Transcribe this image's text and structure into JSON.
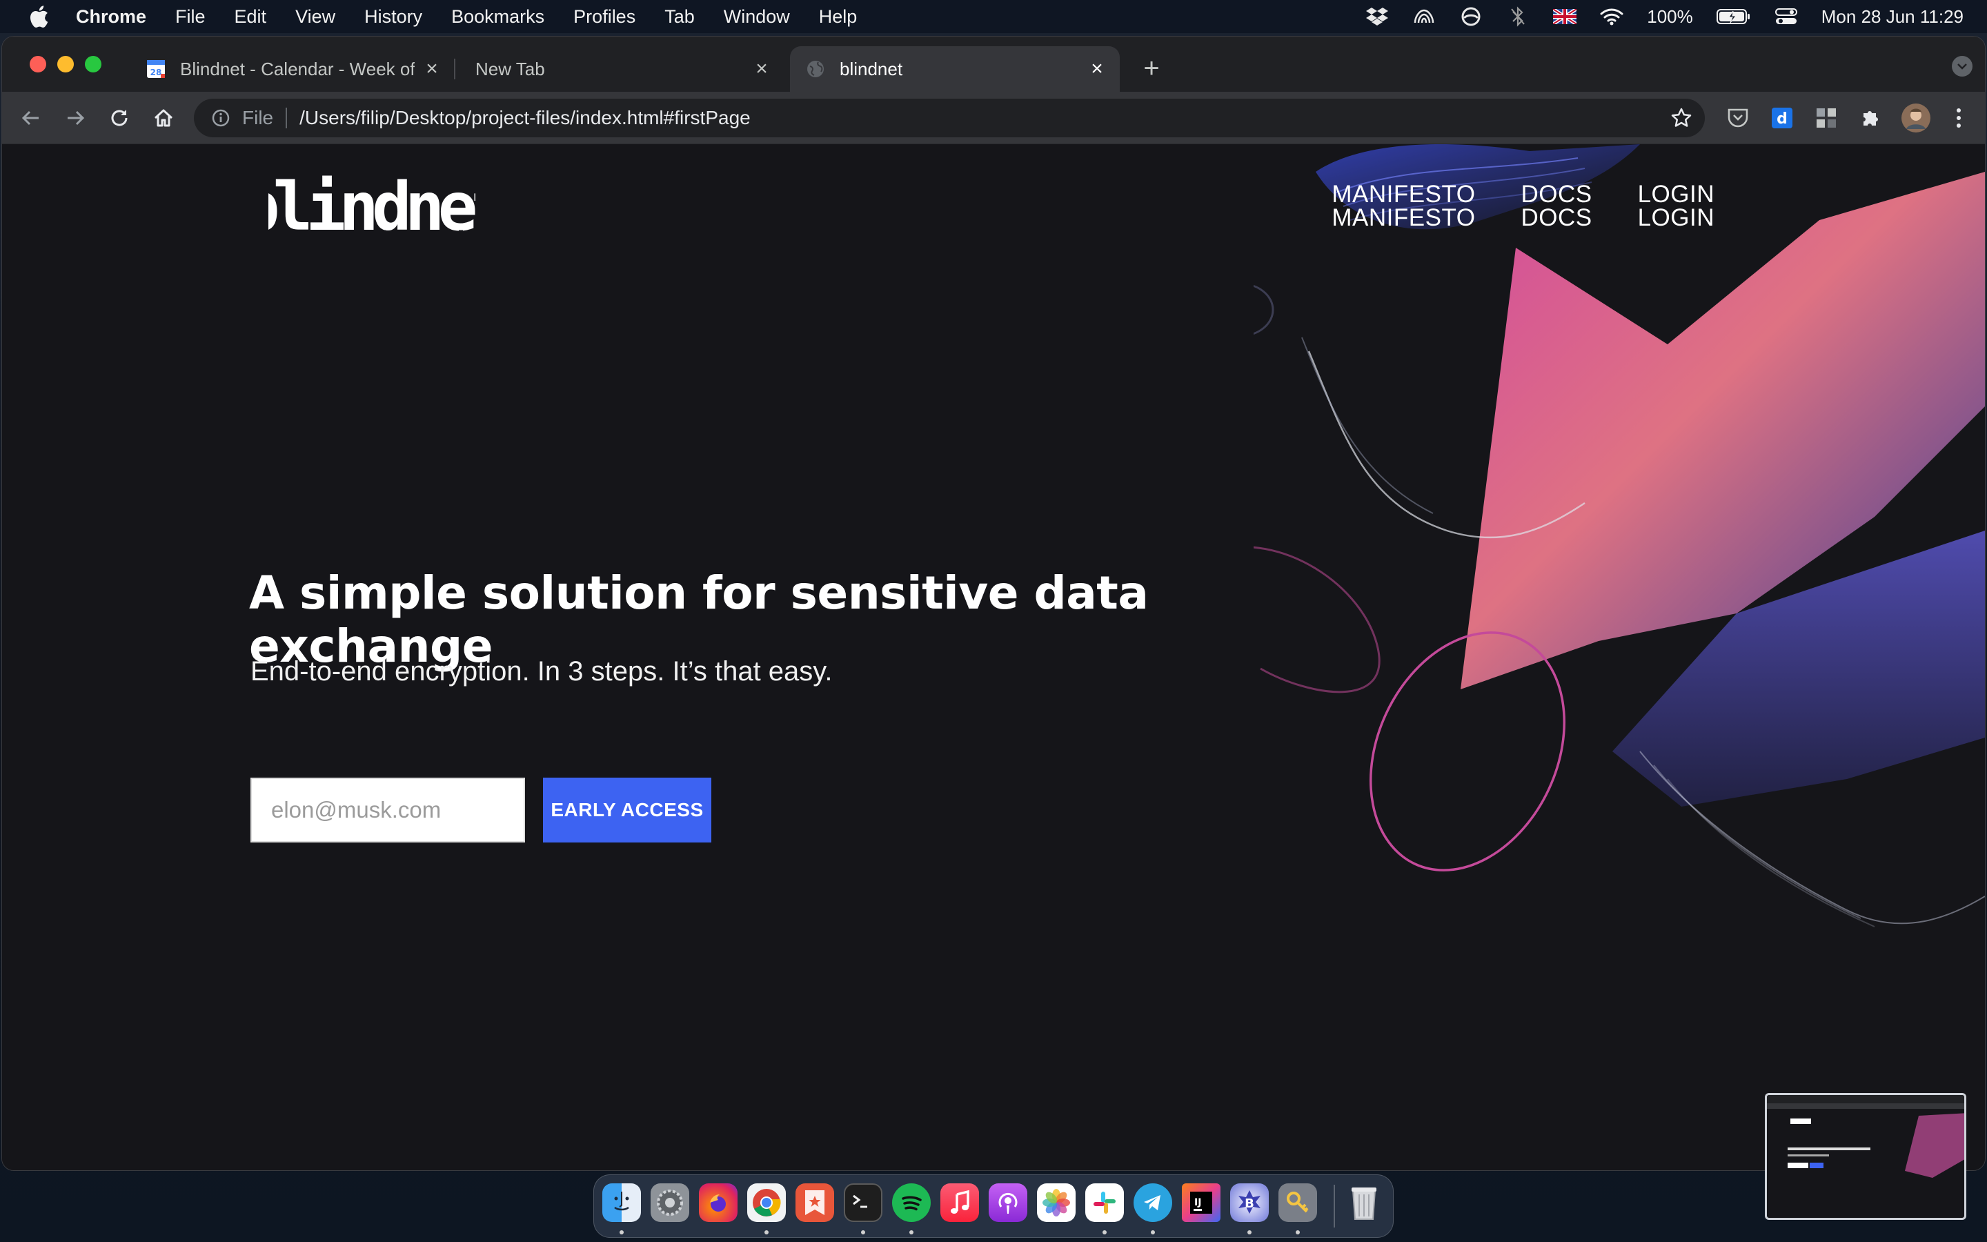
{
  "menubar": {
    "items": [
      "Chrome",
      "File",
      "Edit",
      "View",
      "History",
      "Bookmarks",
      "Profiles",
      "Tab",
      "Window",
      "Help"
    ],
    "status_icons": [
      "dropbox-icon",
      "creative-cloud-icon",
      "focus-icon",
      "bluetooth-icon",
      "uk-flag-icon",
      "wifi-icon"
    ],
    "battery_percent": "100%",
    "datetime": "Mon 28 Jun  11:29"
  },
  "browser": {
    "tabs": [
      {
        "title": "Blindnet - Calendar - Week of ...",
        "favicon": "calendar-icon",
        "active": false
      },
      {
        "title": "New Tab",
        "favicon": "",
        "active": false
      },
      {
        "title": "blindnet",
        "favicon": "globe-icon",
        "active": true
      }
    ],
    "address": {
      "scheme": "File",
      "url": "/Users/filip/Desktop/project-files/index.html#firstPage"
    }
  },
  "page": {
    "logo_text": "blindnet",
    "nav": [
      {
        "label": "MANIFESTO",
        "label_dup": "MANIFESTO"
      },
      {
        "label": "DOCS",
        "label_dup": "DOCS"
      },
      {
        "label": "LOGIN",
        "label_dup": "LOGIN"
      }
    ],
    "hero_title": "A simple solution for sensitive data exchange",
    "hero_subtitle": "End-to-end encryption. In 3 steps. It’s that easy.",
    "email_placeholder": "elon@musk.com",
    "cta_label": "EARLY ACCESS",
    "colors": {
      "accent": "#3d63f2",
      "background": "#151519"
    }
  },
  "dock": {
    "apps": [
      "finder-icon",
      "system-preferences-icon",
      "firefox-icon",
      "chrome-icon",
      "reeder-icon",
      "terminal-icon",
      "spotify-icon",
      "music-icon",
      "podcasts-icon",
      "photos-icon",
      "slack-icon",
      "telegram-icon",
      "intellij-icon",
      "bbedit-icon",
      "keychain-icon"
    ],
    "trash": "trash-icon"
  }
}
